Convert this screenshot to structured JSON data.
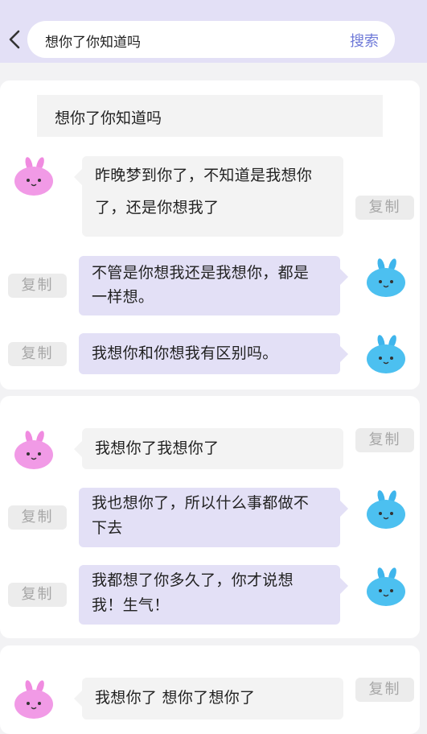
{
  "header": {
    "back_icon": "chevron-left-icon",
    "search_value": "想你了你知道吗",
    "search_button": "搜索"
  },
  "colors": {
    "header_bg": "#e3e0f6",
    "accent": "#6f7ad8",
    "left_bubble": "#f3f3f3",
    "right_bubble": "#e3e0f6"
  },
  "copy_label": "复制",
  "cards": [
    {
      "quote": "想你了你知道吗",
      "messages": [
        {
          "side": "left",
          "lines": [
            "昨晚梦到你了，不知道是我想你",
            "了，还是你想我了"
          ]
        },
        {
          "side": "right",
          "lines": [
            "不管是你想我还是我想你，都是",
            "一样想。"
          ]
        },
        {
          "side": "right",
          "lines": [
            "我想你和你想我有区别吗。"
          ]
        }
      ]
    },
    {
      "messages": [
        {
          "side": "left",
          "lines": [
            "我想你了我想你了"
          ]
        },
        {
          "side": "right",
          "lines": [
            "我也想你了，所以什么事都做不",
            "下去"
          ]
        },
        {
          "side": "right",
          "lines": [
            "我都想了你多久了，你才说想",
            "我！生气！"
          ]
        }
      ]
    },
    {
      "messages": [
        {
          "side": "left",
          "lines": [
            "我想你了 想你了想你了"
          ]
        }
      ]
    }
  ]
}
